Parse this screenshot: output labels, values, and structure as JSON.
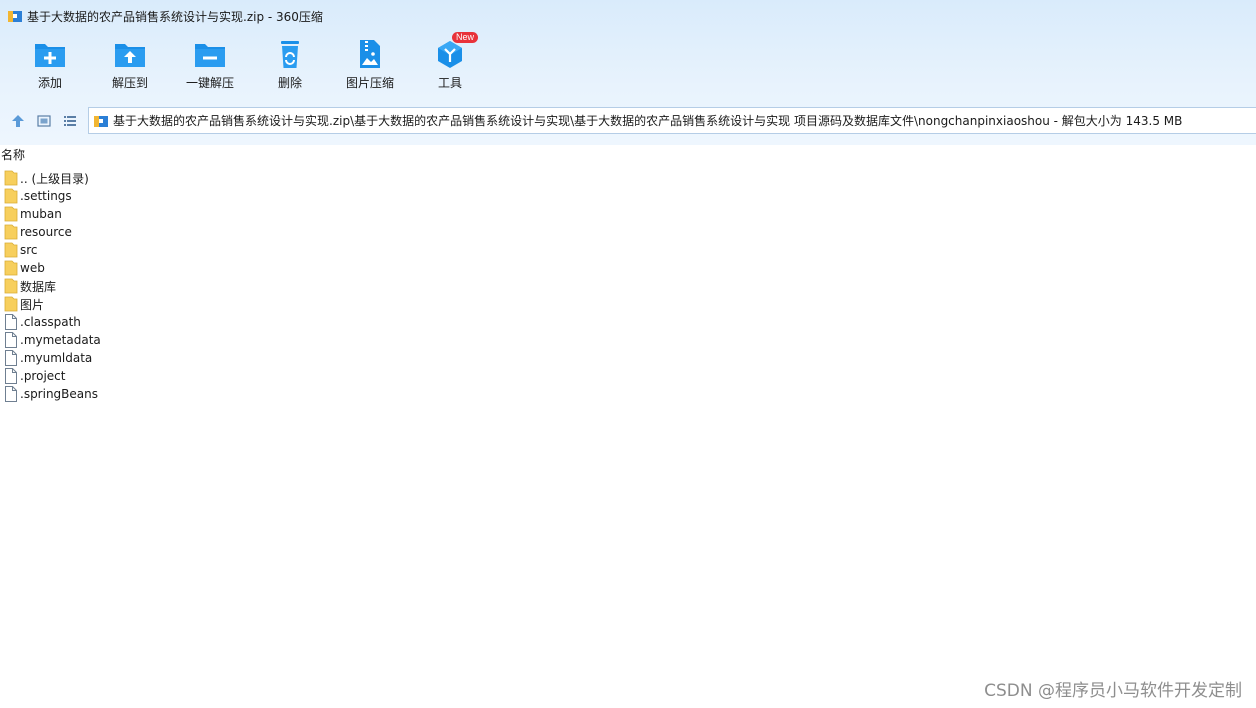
{
  "window": {
    "title": "基于大数据的农产品销售系统设计与实现.zip - 360压缩",
    "app_icon": "archive-app-icon"
  },
  "toolbar": {
    "buttons": [
      {
        "id": "add",
        "label": "添加",
        "icon": "folder-plus-icon"
      },
      {
        "id": "extract-to",
        "label": "解压到",
        "icon": "folder-upload-icon"
      },
      {
        "id": "one-click-extract",
        "label": "一键解压",
        "icon": "folder-minus-icon"
      },
      {
        "id": "delete",
        "label": "删除",
        "icon": "recycle-bin-icon"
      },
      {
        "id": "image-compress",
        "label": "图片压缩",
        "icon": "image-zip-icon"
      },
      {
        "id": "tools",
        "label": "工具",
        "icon": "tools-cube-icon",
        "badge": "New"
      }
    ]
  },
  "navbar": {
    "up_icon": "up-arrow-icon",
    "thumbnail_view_icon": "thumbnail-view-icon",
    "list_view_icon": "list-view-icon",
    "address": "基于大数据的农产品销售系统设计与实现.zip\\基于大数据的农产品销售系统设计与实现\\基于大数据的农产品销售系统设计与实现 项目源码及数据库文件\\nongchanpinxiaoshou - 解包大小为 143.5 MB"
  },
  "list": {
    "column_name": "名称",
    "items": [
      {
        "name": ".. (上级目录)",
        "type": "folder"
      },
      {
        "name": ".settings",
        "type": "folder"
      },
      {
        "name": "muban",
        "type": "folder"
      },
      {
        "name": "resource",
        "type": "folder"
      },
      {
        "name": "src",
        "type": "folder"
      },
      {
        "name": "web",
        "type": "folder"
      },
      {
        "name": "数据库",
        "type": "folder"
      },
      {
        "name": "图片",
        "type": "folder"
      },
      {
        "name": ".classpath",
        "type": "file"
      },
      {
        "name": ".mymetadata",
        "type": "file"
      },
      {
        "name": ".myumldata",
        "type": "file"
      },
      {
        "name": ".project",
        "type": "file"
      },
      {
        "name": ".springBeans",
        "type": "file"
      }
    ]
  },
  "watermark": "CSDN @程序员小马软件开发定制",
  "colors": {
    "accent": "#1a8fe8",
    "folder": "#f7cf5d",
    "badge": "#e8323a"
  }
}
